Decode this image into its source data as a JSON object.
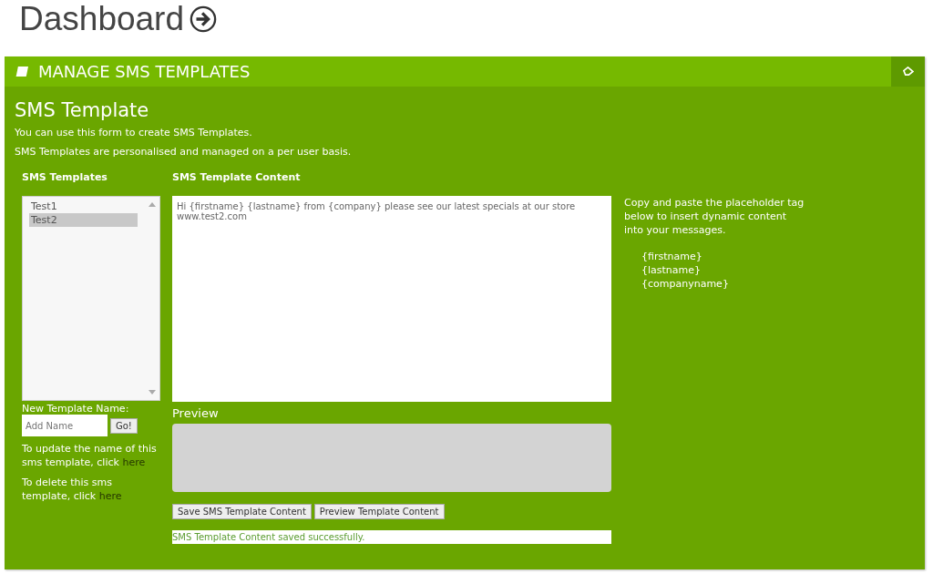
{
  "page": {
    "title": "Dashboard"
  },
  "panel": {
    "title": "MANAGE SMS TEMPLATES",
    "heading": "SMS Template",
    "intro": [
      "You can use this form to create SMS Templates.",
      "SMS Templates are personalised and managed on a per user basis."
    ],
    "templates": {
      "label": "SMS Templates",
      "items": [
        {
          "label": "Test1",
          "selected": false
        },
        {
          "label": "Test2",
          "selected": true
        }
      ],
      "new_name_label": "New Template Name:",
      "new_name": {
        "placeholder": "Add Name"
      },
      "go_button": "Go!",
      "notes": [
        {
          "text": "To update the name of this sms template, click",
          "link": "here"
        },
        {
          "text": "To delete this sms template, click",
          "link": "here"
        }
      ]
    },
    "content": {
      "label": "SMS Template Content",
      "value": "Hi {firstname} {lastname} from {company} please see our latest specials at our store www.test2.com",
      "preview_label": "Preview",
      "buttons": [
        "Save SMS Template Content",
        "Preview Template Content"
      ],
      "status": "SMS Template Content saved successfully."
    },
    "help": {
      "text": "Copy and paste the placeholder tag below to insert dynamic content into your messages.",
      "tags": [
        "{firstname}",
        "{lastname}",
        "{companyname}"
      ]
    }
  }
}
